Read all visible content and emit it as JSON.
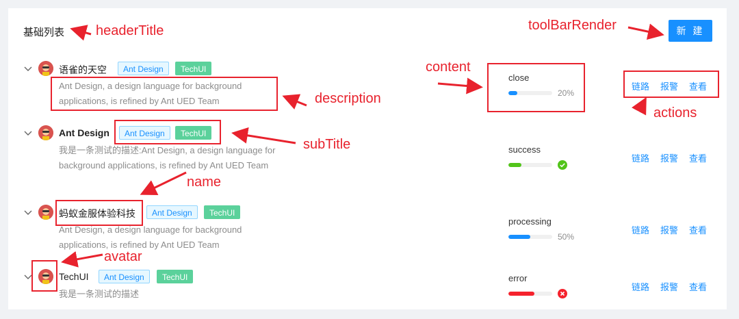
{
  "header": {
    "title": "基础列表",
    "new_button": "新 建"
  },
  "annotations": {
    "headerTitle": "headerTitle",
    "toolBarRender": "toolBarRender",
    "content": "content",
    "description": "description",
    "actions": "actions",
    "subTitle": "subTitle",
    "name": "name",
    "avatar": "avatar"
  },
  "tags": {
    "ant": "Ant Design",
    "tech": "TechUI"
  },
  "actions": {
    "link": "链路",
    "alarm": "报警",
    "view": "查看"
  },
  "rows": [
    {
      "name": "语雀的天空",
      "description": "Ant Design, a design language for background applications, is refined by Ant UED Team",
      "status": "close",
      "progress": 20,
      "progress_label": "20%",
      "progress_color": "#1890ff"
    },
    {
      "name": "Ant Design",
      "description": "我是一条测试的描述:Ant Design, a design language for background applications, is refined by Ant UED Team",
      "status": "success",
      "progress": 30,
      "progress_color": "#52c41a",
      "status_icon": "check-circle-icon"
    },
    {
      "name": "蚂蚁金服体验科技",
      "description": "Ant Design, a design language for background applications, is refined by Ant UED Team",
      "status": "processing",
      "progress": 50,
      "progress_label": "50%",
      "progress_color": "#1890ff"
    },
    {
      "name": "TechUI",
      "description": "我是一条测试的描述",
      "status": "error",
      "progress": 60,
      "progress_color": "#f5222d",
      "status_icon": "close-circle-icon"
    }
  ]
}
